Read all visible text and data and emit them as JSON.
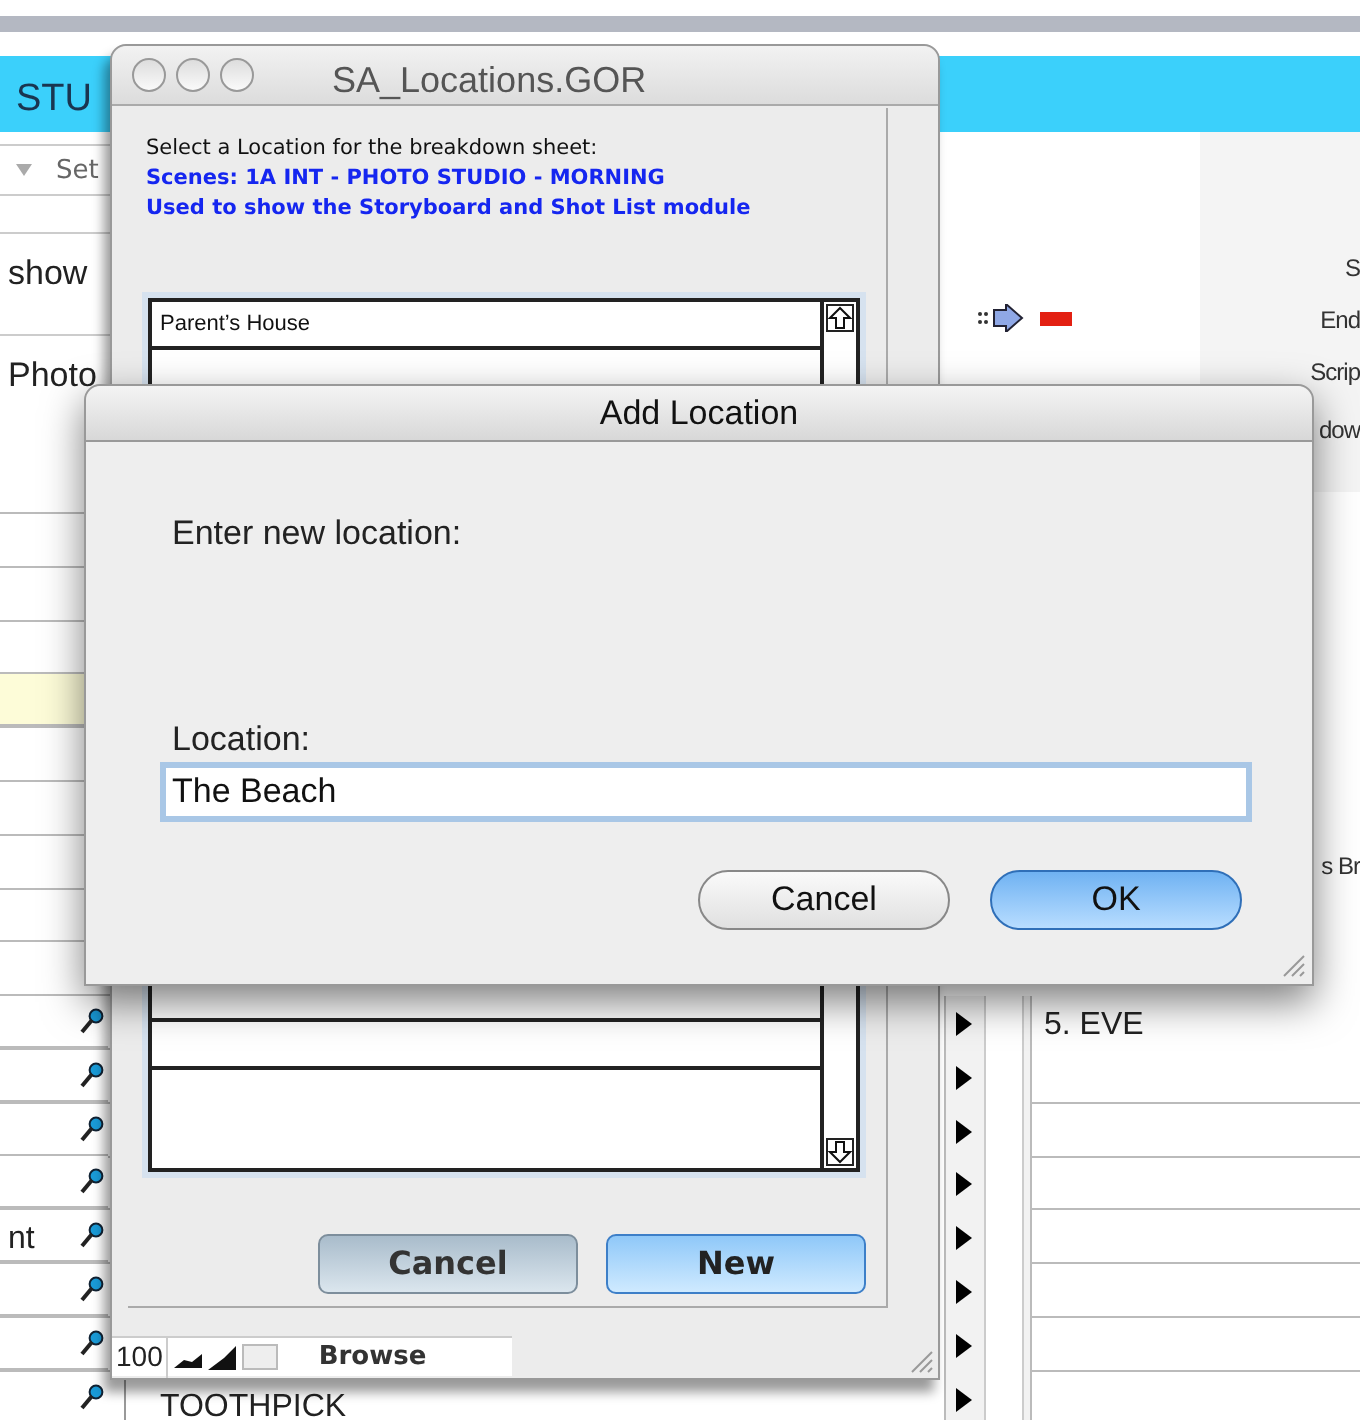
{
  "app": {
    "header_partial": "STU",
    "toolbar_partial": "Set",
    "left_labels": [
      "show",
      "Photo"
    ],
    "rows": [
      {
        "highlighted": true,
        "kind": "plain"
      },
      {
        "highlighted": false,
        "kind": "key"
      },
      {
        "highlighted": false,
        "kind": "key"
      },
      {
        "highlighted": false,
        "kind": "key"
      },
      {
        "highlighted": false,
        "kind": "key"
      },
      {
        "text": "nt",
        "highlighted": false,
        "kind": "key"
      },
      {
        "highlighted": false,
        "kind": "key"
      },
      {
        "highlighted": false,
        "kind": "key"
      },
      {
        "highlighted": false,
        "kind": "key",
        "item": "TOOTHPICK"
      }
    ],
    "right_labels": [
      "S",
      "End",
      "Scrip",
      "dow",
      "s Br"
    ],
    "notes": [
      "5. EVE"
    ]
  },
  "locations_window": {
    "title": "SA_Locations.GOR",
    "prompt": "Select a Location for the breakdown sheet:",
    "scene_line": "Scenes: 1A INT - PHOTO STUDIO - MORNING",
    "usage_line": "Used to show the Storyboard and Shot List module",
    "locations": [
      "Parent’s House"
    ],
    "buttons": [
      {
        "label": "Cancel",
        "default": false
      },
      {
        "label": "New",
        "default": true
      }
    ],
    "status_bar": {
      "zoom": "100",
      "mode": "Browse"
    }
  },
  "dialog": {
    "title": "Add Location",
    "prompt": "Enter new location:",
    "field_label": "Location:",
    "value": "The Beach",
    "buttons": [
      {
        "label": "Cancel",
        "default": false
      },
      {
        "label": "OK",
        "default": true
      }
    ]
  }
}
